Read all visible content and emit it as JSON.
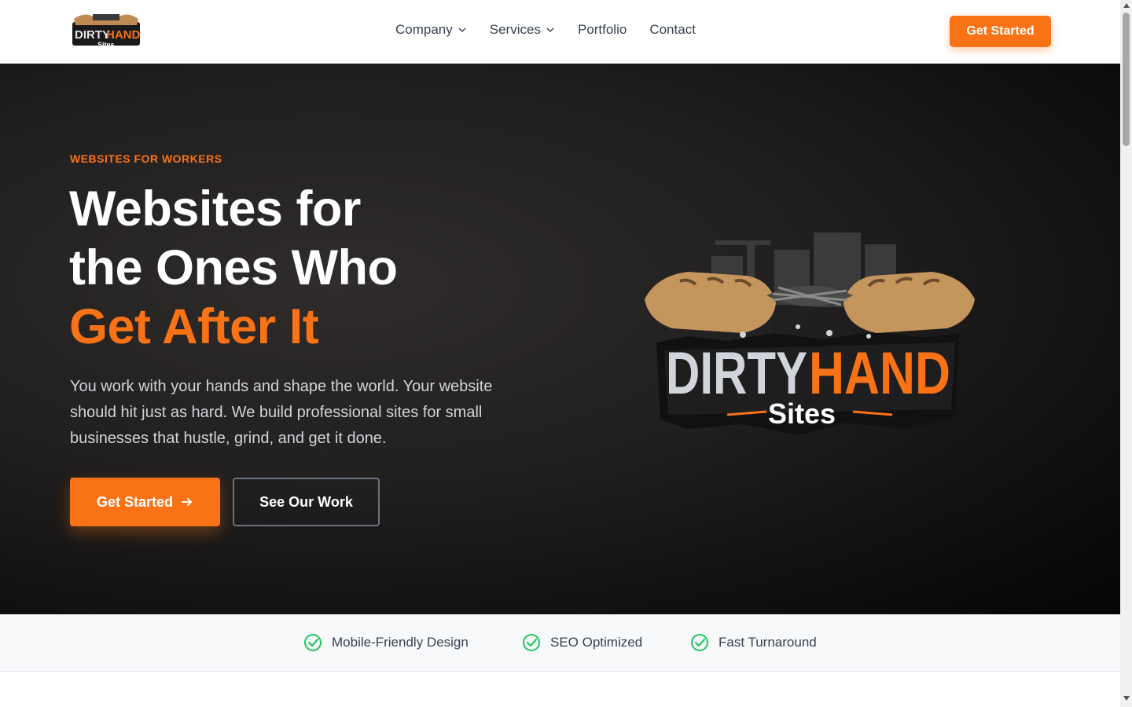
{
  "brand": {
    "logo_top": "DIRTY",
    "logo_accent": "HAND",
    "logo_sub": "Sites"
  },
  "nav": {
    "items": [
      {
        "label": "Company",
        "has_dropdown": true
      },
      {
        "label": "Services",
        "has_dropdown": true
      },
      {
        "label": "Portfolio",
        "has_dropdown": false
      },
      {
        "label": "Contact",
        "has_dropdown": false
      }
    ],
    "cta_label": "Get Started"
  },
  "hero": {
    "eyebrow": "WEBSITES FOR WORKERS",
    "headline_line1": "Websites for",
    "headline_line2": "the Ones Who",
    "headline_accent": "Get After It",
    "lead": "You work with your hands and shape the world. Your website should hit just as hard. We build professional sites for small businesses that hustle, grind, and get it done.",
    "primary_cta": "Get Started",
    "secondary_cta": "See Our Work"
  },
  "features": [
    {
      "label": "Mobile-Friendly Design",
      "icon": "check-circle-icon"
    },
    {
      "label": "SEO Optimized",
      "icon": "check-circle-icon"
    },
    {
      "label": "Fast Turnaround",
      "icon": "check-circle-icon"
    }
  ],
  "colors": {
    "accent": "#f97316",
    "check": "#22c55e",
    "hero_bg": "#1a1818"
  }
}
